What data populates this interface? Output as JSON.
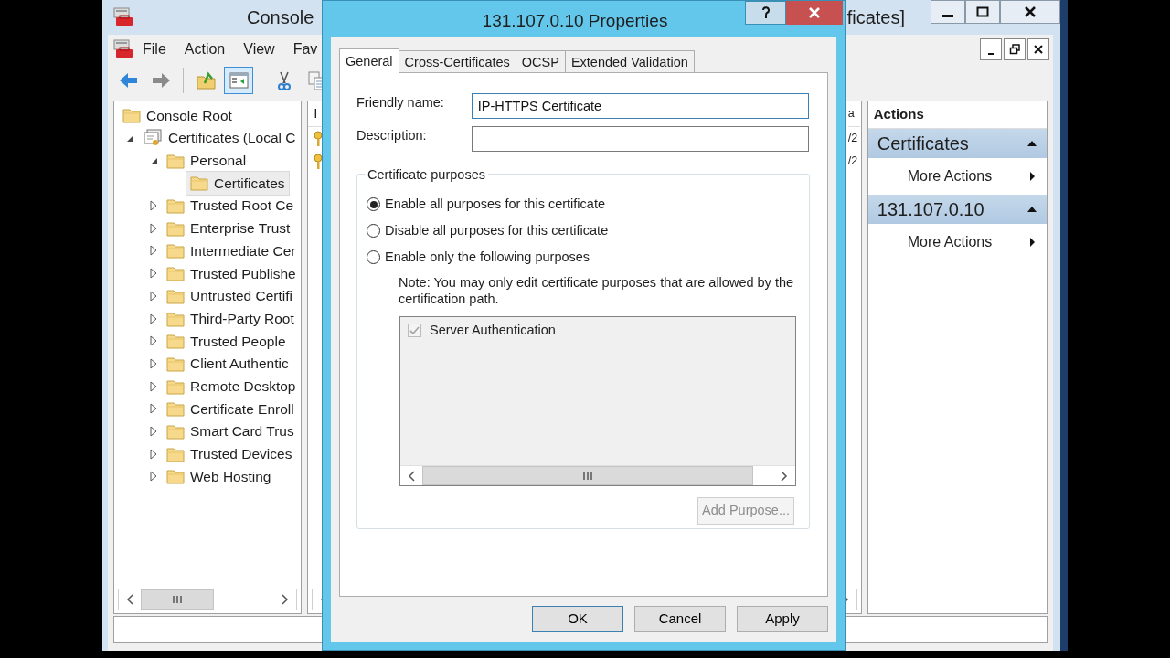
{
  "main_window": {
    "title_start": "Console",
    "title_end": "ficates]"
  },
  "menu": [
    {
      "label": "File"
    },
    {
      "label": "Action"
    },
    {
      "label": "View"
    },
    {
      "label": "Fav"
    }
  ],
  "toolbar": [
    {
      "kind": "back",
      "disabled": false,
      "pressed": false
    },
    {
      "kind": "forward",
      "disabled": true,
      "pressed": false
    },
    {
      "kind": "up",
      "disabled": false,
      "pressed": false
    },
    {
      "kind": "tree",
      "disabled": false,
      "pressed": true
    },
    {
      "kind": "cut",
      "disabled": false,
      "pressed": false
    },
    {
      "kind": "copy",
      "disabled": false,
      "pressed": false
    }
  ],
  "tree": [
    {
      "label": "Console Root",
      "selected": false,
      "children": [
        {
          "label": "Certificates (Local C",
          "selected": false,
          "expanded": true,
          "children": [
            {
              "label": "Personal",
              "selected": false,
              "expanded": true,
              "children": [
                {
                  "label": "Certificates",
                  "selected": true
                }
              ]
            },
            {
              "label": "Trusted Root Ce",
              "selected": false,
              "expanded": false
            },
            {
              "label": "Enterprise Trust",
              "selected": false,
              "expanded": false
            },
            {
              "label": "Intermediate Cer",
              "selected": false,
              "expanded": false
            },
            {
              "label": "Trusted Publishe",
              "selected": false,
              "expanded": false
            },
            {
              "label": "Untrusted Certifi",
              "selected": false,
              "expanded": false
            },
            {
              "label": "Third-Party Root",
              "selected": false,
              "expanded": false
            },
            {
              "label": "Trusted People",
              "selected": false,
              "expanded": false
            },
            {
              "label": "Client Authentic",
              "selected": false,
              "expanded": false
            },
            {
              "label": "Remote Desktop",
              "selected": false,
              "expanded": false
            },
            {
              "label": "Certificate Enroll",
              "selected": false,
              "expanded": false
            },
            {
              "label": "Smart Card Trus",
              "selected": false,
              "expanded": false
            },
            {
              "label": "Trusted Devices",
              "selected": false,
              "expanded": false
            },
            {
              "label": "Web Hosting",
              "selected": false,
              "expanded": false
            }
          ]
        }
      ]
    }
  ],
  "middle_pane": {
    "header_start": "I",
    "header_end": "a",
    "row_ends": [
      "/2",
      "/2"
    ]
  },
  "actions": {
    "header": "Actions",
    "sections": [
      {
        "title": "Certificates",
        "expanded": true,
        "items": [
          "More Actions"
        ]
      },
      {
        "title": "131.107.0.10",
        "expanded": true,
        "items": [
          "More Actions"
        ]
      }
    ]
  },
  "dialog": {
    "title": "131.107.0.10 Properties",
    "tabs": [
      {
        "label": "General",
        "selected": true
      },
      {
        "label": "Cross-Certificates",
        "selected": false
      },
      {
        "label": "OCSP",
        "selected": false
      },
      {
        "label": "Extended Validation",
        "selected": false
      }
    ],
    "friendly_name": {
      "label": "Friendly name:",
      "value": "IP-HTTPS Certificate"
    },
    "description": {
      "label": "Description:"
    },
    "purposes": {
      "title": "Certificate purposes",
      "options": [
        {
          "label": "Enable all purposes for this certificate",
          "selected": true
        },
        {
          "label": "Disable all purposes for this certificate",
          "selected": false
        },
        {
          "label": "Enable only the following purposes",
          "selected": false
        }
      ],
      "note": "Note: You may only edit certificate purposes that are allowed by the certification path.",
      "list": [
        {
          "label": "Server Authentication",
          "checked": true,
          "disabled": true
        }
      ],
      "add_button": {
        "label": "Add Purpose...",
        "disabled": true
      }
    },
    "buttons": [
      {
        "label": "OK",
        "default": true
      },
      {
        "label": "Cancel",
        "default": false
      },
      {
        "label": "Apply",
        "default": false
      }
    ]
  }
}
